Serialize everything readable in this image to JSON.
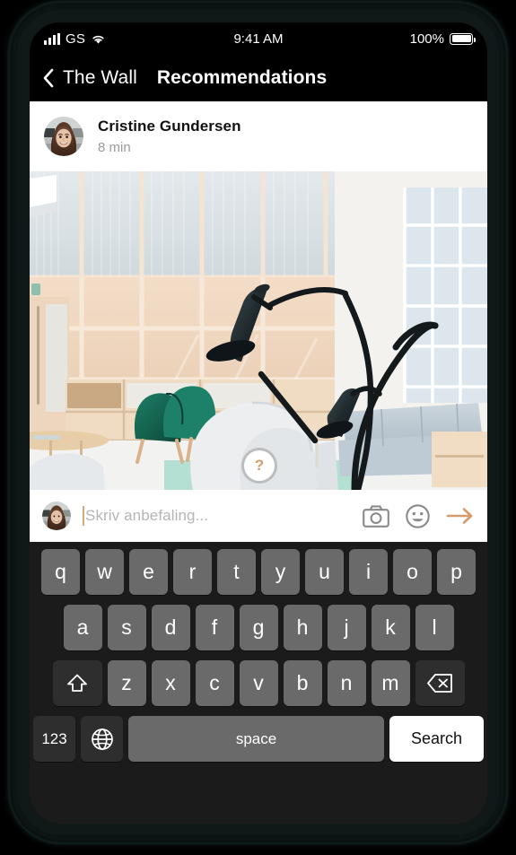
{
  "status_bar": {
    "carrier": "GS",
    "time": "9:41 AM",
    "battery_percent": "100%",
    "signal_icon": "signal-bars-icon",
    "wifi_icon": "wifi-icon",
    "battery_icon": "battery-full-icon"
  },
  "nav_bar": {
    "back_label": "The Wall",
    "back_icon": "chevron-left-icon",
    "title": "Recommendations"
  },
  "post": {
    "user_name": "Cristine Gundersen",
    "time_ago": "8 min",
    "avatar_icon": "user-avatar",
    "photo_alt": "interior-photo",
    "help_badge_label": "?"
  },
  "composer": {
    "avatar_icon": "user-avatar-small",
    "placeholder": "Skriv anbefaling...",
    "camera_icon": "camera-icon",
    "emoji_icon": "smiley-icon",
    "send_icon": "arrow-right-icon"
  },
  "keyboard": {
    "row1": [
      "q",
      "w",
      "e",
      "r",
      "t",
      "y",
      "u",
      "i",
      "o",
      "p"
    ],
    "row2": [
      "a",
      "s",
      "d",
      "f",
      "g",
      "h",
      "j",
      "k",
      "l"
    ],
    "row3": [
      "z",
      "x",
      "c",
      "v",
      "b",
      "n",
      "m"
    ],
    "shift_icon": "shift-icon",
    "backspace_icon": "backspace-icon",
    "numbers_label": "123",
    "globe_icon": "globe-icon",
    "space_label": "space",
    "search_label": "Search"
  },
  "colors": {
    "accent": "#d79a6a",
    "nav_background": "#000000",
    "keyboard_background": "#1b1b1b",
    "key_background": "#6a6a6a",
    "key_dark_background": "#2e2e2e",
    "search_key_background": "#ffffff"
  }
}
